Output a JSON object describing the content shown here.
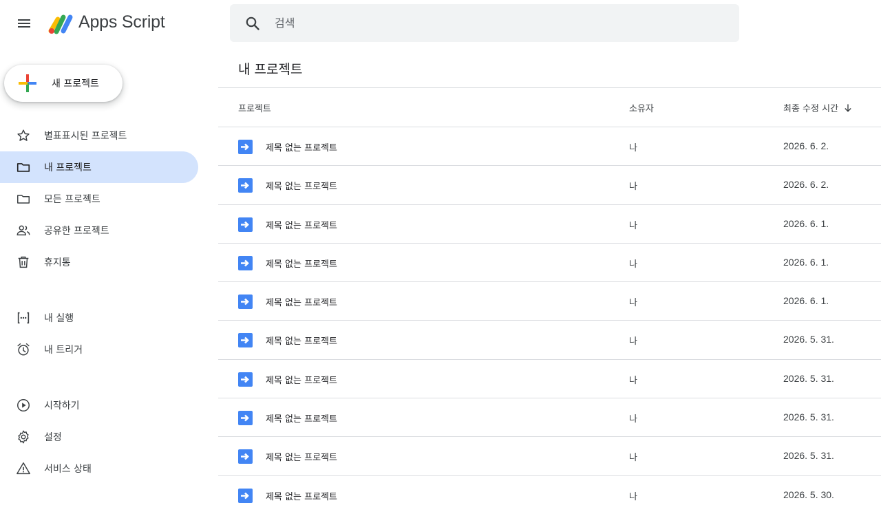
{
  "app": {
    "title": "Apps Script"
  },
  "search": {
    "placeholder": "검색"
  },
  "new_project": {
    "label": "새 프로젝트"
  },
  "sidebar": {
    "items": [
      {
        "label": "별표표시된 프로젝트",
        "icon": "star-icon"
      },
      {
        "label": "내 프로젝트",
        "icon": "folder-icon",
        "active": true
      },
      {
        "label": "모든 프로젝트",
        "icon": "folder-icon"
      },
      {
        "label": "공유한 프로젝트",
        "icon": "people-icon"
      },
      {
        "label": "휴지통",
        "icon": "trash-icon"
      },
      {
        "label": "내 실행",
        "icon": "executions-icon"
      },
      {
        "label": "내 트리거",
        "icon": "alarm-icon"
      },
      {
        "label": "시작하기",
        "icon": "play-icon"
      },
      {
        "label": "설정",
        "icon": "gear-icon"
      },
      {
        "label": "서비스 상태",
        "icon": "warning-icon"
      }
    ]
  },
  "main": {
    "title": "내 프로젝트",
    "columns": {
      "project": "프로젝트",
      "owner": "소유자",
      "modified": "최종 수정 시간"
    },
    "rows": [
      {
        "name": "제목 없는 프로젝트",
        "owner": "나",
        "date": "2026. 6. 2."
      },
      {
        "name": "제목 없는 프로젝트",
        "owner": "나",
        "date": "2026. 6. 2."
      },
      {
        "name": "제목 없는 프로젝트",
        "owner": "나",
        "date": "2026. 6. 1."
      },
      {
        "name": "제목 없는 프로젝트",
        "owner": "나",
        "date": "2026. 6. 1."
      },
      {
        "name": "제목 없는 프로젝트",
        "owner": "나",
        "date": "2026. 6. 1."
      },
      {
        "name": "제목 없는 프로젝트",
        "owner": "나",
        "date": "2026. 5. 31."
      },
      {
        "name": "제목 없는 프로젝트",
        "owner": "나",
        "date": "2026. 5. 31."
      },
      {
        "name": "제목 없는 프로젝트",
        "owner": "나",
        "date": "2026. 5. 31."
      },
      {
        "name": "제목 없는 프로젝트",
        "owner": "나",
        "date": "2026. 5. 31."
      },
      {
        "name": "제목 없는 프로젝트",
        "owner": "나",
        "date": "2026. 5. 30."
      }
    ]
  },
  "colors": {
    "accent": "#d3e3fd",
    "file_icon": "#4285f4",
    "search_bg": "#f1f3f4"
  }
}
